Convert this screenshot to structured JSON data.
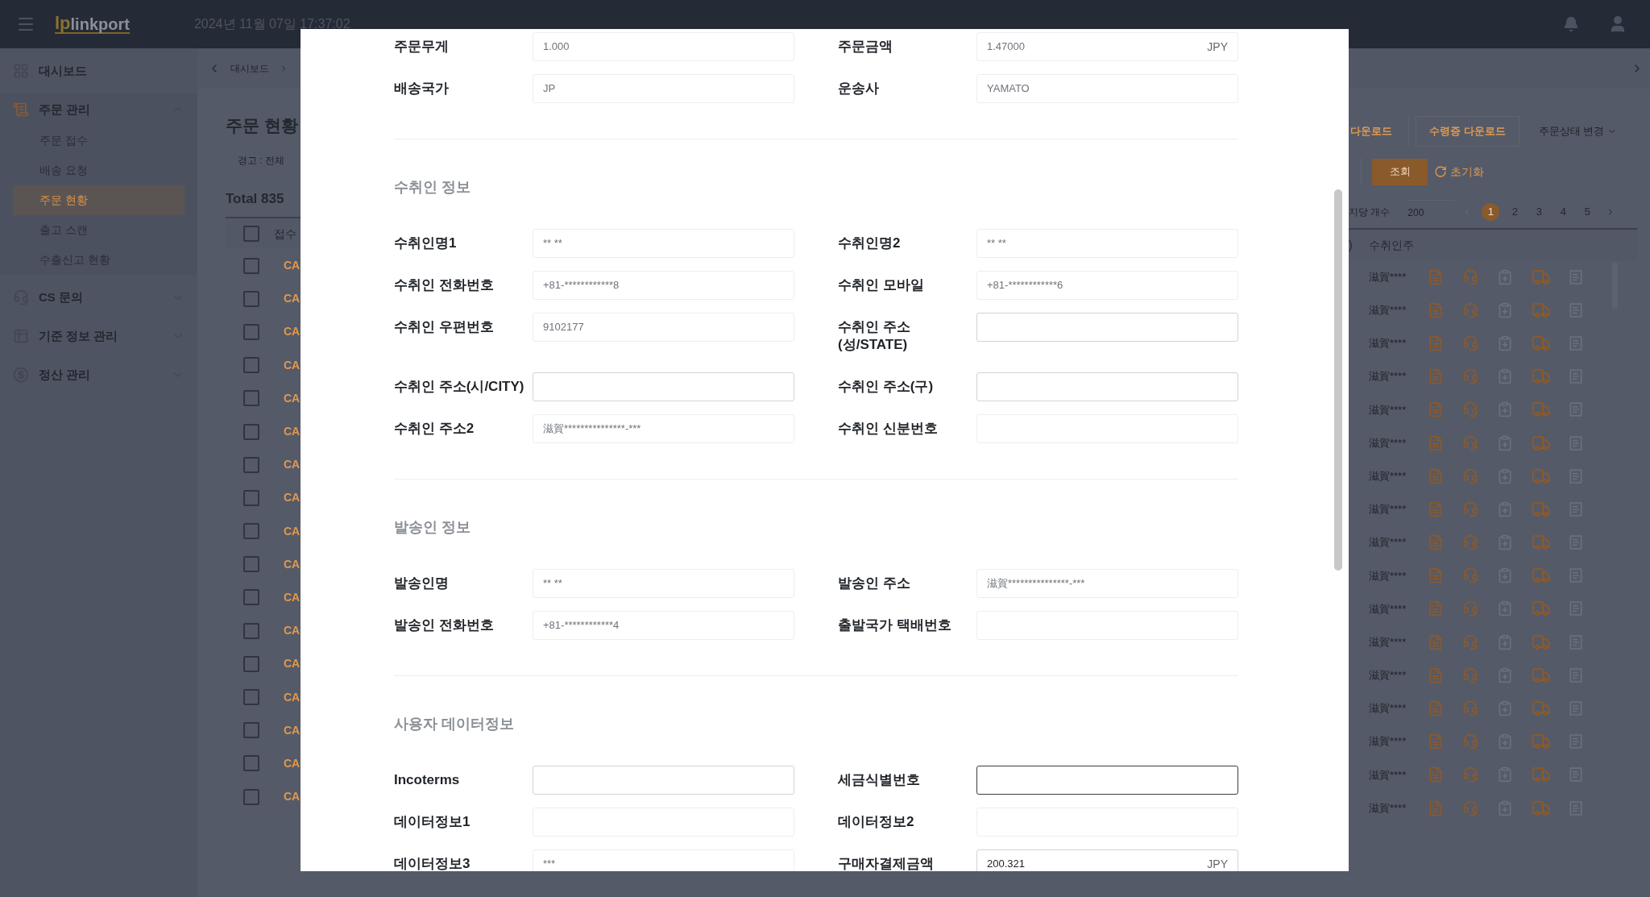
{
  "header": {
    "logo": {
      "mark": "lp",
      "name": "linkport"
    },
    "datetime": "2024년 11월 07일 17:37:02"
  },
  "sidebar": {
    "items": [
      {
        "label": "대시보드",
        "kind": "link"
      },
      {
        "label": "주문 관리",
        "kind": "group",
        "expanded": true,
        "children": [
          {
            "label": "주문 접수",
            "selected": false
          },
          {
            "label": "배송 요청",
            "selected": false
          },
          {
            "label": "주문 현황",
            "selected": true
          },
          {
            "label": "출고 스캔",
            "selected": false
          },
          {
            "label": "수출신고 현황",
            "selected": false
          }
        ]
      },
      {
        "label": "CS 문의",
        "kind": "group",
        "expanded": false
      },
      {
        "label": "기준 정보 관리",
        "kind": "group",
        "expanded": false
      },
      {
        "label": "정산 관리",
        "kind": "group",
        "expanded": false
      }
    ]
  },
  "page": {
    "breadcrumb": "대시보드",
    "title": "주문 현황",
    "filter": "경고 : 전체",
    "total": "Total 835",
    "toolbar": [
      {
        "label": "다운로드",
        "kind": "outline"
      },
      {
        "label": "수령증 다운로드",
        "kind": "outline"
      },
      {
        "label": "주문상태 변경",
        "kind": "dropdown"
      }
    ],
    "search_button": "조회",
    "reset_button": "초기화",
    "page_size": {
      "label": "지당 개수",
      "value": "200"
    },
    "pages": [
      {
        "label": "1",
        "selected": true
      },
      {
        "label": "2",
        "selected": false
      },
      {
        "label": "3",
        "selected": false
      },
      {
        "label": "4",
        "selected": false
      },
      {
        "label": "5",
        "selected": false
      }
    ],
    "table": {
      "columns": [
        "접수",
        ")",
        "수취인주"
      ],
      "header_checked": false,
      "rows": [
        {
          "checked": false,
          "column_1": "CA",
          "column_3": "滋賀****"
        },
        {
          "checked": false,
          "column_1": "CA",
          "column_3": "滋賀****"
        },
        {
          "checked": false,
          "column_1": "CA",
          "column_3": "滋賀****"
        },
        {
          "checked": false,
          "column_1": "CA",
          "column_3": "滋賀****"
        },
        {
          "checked": false,
          "column_1": "CA",
          "column_3": "滋賀****"
        },
        {
          "checked": false,
          "column_1": "CA",
          "column_3": "滋賀****"
        },
        {
          "checked": false,
          "column_1": "CA",
          "column_3": "滋賀****"
        },
        {
          "checked": false,
          "column_1": "CA",
          "column_3": "滋賀****"
        },
        {
          "checked": false,
          "column_1": "CA",
          "column_3": "滋賀****"
        },
        {
          "checked": false,
          "column_1": "CA",
          "column_3": "滋賀****"
        },
        {
          "checked": false,
          "column_1": "CA",
          "column_3": "滋賀****"
        },
        {
          "checked": false,
          "column_1": "CA",
          "column_3": "滋賀****"
        },
        {
          "checked": false,
          "column_1": "CA",
          "column_3": "滋賀****"
        },
        {
          "checked": false,
          "column_1": "CA",
          "column_3": "滋賀****"
        },
        {
          "checked": false,
          "column_1": "CA",
          "column_3": "滋賀****"
        },
        {
          "checked": false,
          "column_1": "CA",
          "column_3": "滋賀****"
        },
        {
          "checked": false,
          "column_1": "CA",
          "column_3": "滋賀****"
        }
      ]
    }
  },
  "modal": {
    "sections": [
      {
        "fields": [
          {
            "label": "주문무게",
            "value": "1.000",
            "editable": false,
            "focused": false
          },
          {
            "label": "주문금액",
            "value": "1.47000",
            "unit": "JPY",
            "editable": false,
            "focused": false
          },
          {
            "label": "배송국가",
            "value": "JP",
            "editable": false,
            "focused": false
          },
          {
            "label": "운송사",
            "value": "YAMATO",
            "editable": false,
            "focused": false
          }
        ]
      },
      {
        "title": "수취인 정보",
        "fields": [
          {
            "label": "수취인명1",
            "value": "** **",
            "editable": false,
            "focused": false
          },
          {
            "label": "수취인명2",
            "value": "** **",
            "editable": false,
            "focused": false
          },
          {
            "label": "수취인 전화번호",
            "value": "+81-************8",
            "editable": false,
            "focused": false
          },
          {
            "label": "수취인 모바일",
            "value": "+81-************6",
            "editable": false,
            "focused": false
          },
          {
            "label": "수취인 우편번호",
            "value": "9102177",
            "editable": false,
            "focused": false
          },
          {
            "label": "수취인 주소\n(성/STATE)",
            "editable": true,
            "focused": false
          },
          {
            "label": "수취인 주소(시/CITY)",
            "editable": true,
            "focused": false
          },
          {
            "label": "수취인 주소(구)",
            "editable": true,
            "focused": false
          },
          {
            "label": "수취인 주소2",
            "value": "滋賀***************-***",
            "editable": false,
            "focused": false
          },
          {
            "label": "수취인 신분번호",
            "editable": false,
            "focused": false
          }
        ]
      },
      {
        "title": "발송인 정보",
        "fields": [
          {
            "label": "발송인명",
            "value": "** **",
            "editable": false,
            "focused": false
          },
          {
            "label": "발송인 주소",
            "value": "滋賀***************-***",
            "editable": false,
            "focused": false
          },
          {
            "label": "발송인 전화번호",
            "value": "+81-************4",
            "editable": false,
            "focused": false
          },
          {
            "label": "출발국가 택배번호",
            "editable": false,
            "focused": false
          }
        ]
      },
      {
        "title": "사용자 데이터정보",
        "fields": [
          {
            "label": "Incoterms",
            "editable": true,
            "focused": false
          },
          {
            "label": "세금식별번호",
            "editable": true,
            "focused": true
          },
          {
            "label": "데이터정보1",
            "editable": false,
            "focused": false
          },
          {
            "label": "데이터정보2",
            "editable": false,
            "focused": false
          },
          {
            "label": "데이터정보3",
            "value": "***",
            "editable": false,
            "focused": false
          },
          {
            "label": "구매자결제금액",
            "value": "200.321",
            "unit": "JPY",
            "editable": true,
            "focused": false
          }
        ]
      }
    ]
  }
}
